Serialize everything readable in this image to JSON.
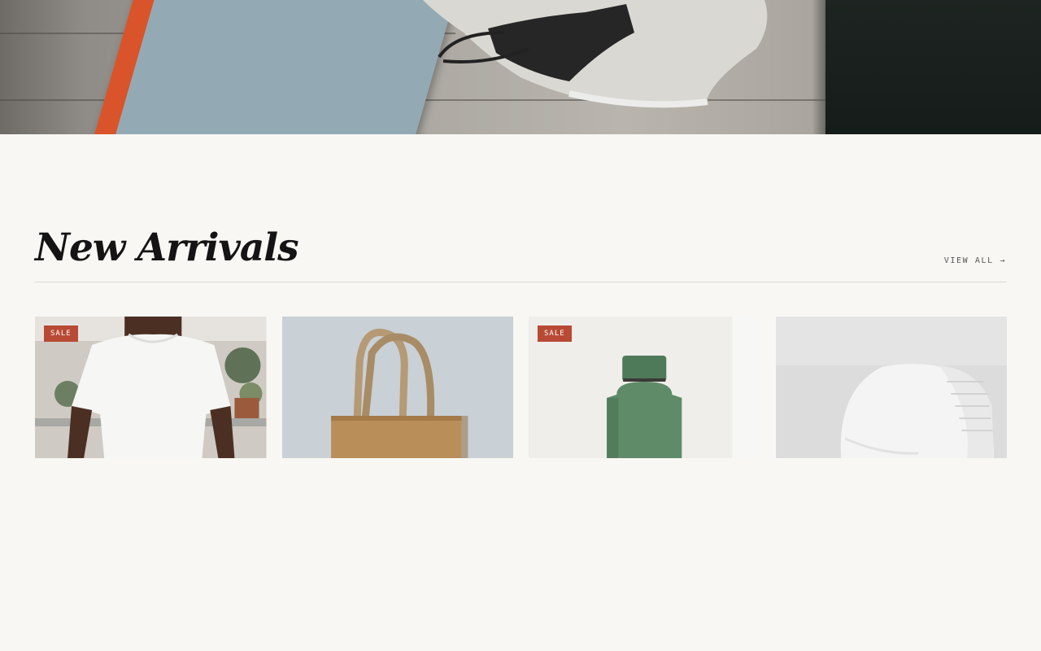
{
  "hero": {
    "image": "shoe-and-notebook-photo"
  },
  "section": {
    "title": "New Arrivals",
    "view_all_label": "VIEW ALL →"
  },
  "products": [
    {
      "image": "white-tshirt-photo",
      "badge": "SALE"
    },
    {
      "image": "tote-bag-photo",
      "badge": ""
    },
    {
      "image": "green-bottle-photo",
      "badge": "SALE"
    },
    {
      "image": "white-cap-photo",
      "badge": ""
    }
  ],
  "colors": {
    "background": "#f8f7f3",
    "badge": "#b84a35",
    "title": "#141414"
  }
}
